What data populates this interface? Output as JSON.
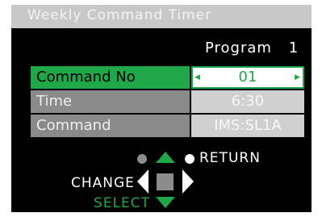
{
  "title": "Weekly Command Timer",
  "program": {
    "label": "Program",
    "number": "1"
  },
  "rows": [
    {
      "label": "Command No",
      "value": "01",
      "selected": true
    },
    {
      "label": "Time",
      "value": "6:30",
      "selected": false
    },
    {
      "label": "Command",
      "value": "IMS:SL1A",
      "selected": false
    }
  ],
  "nav": {
    "return_label": "RETURN",
    "change_label": "CHANGE",
    "select_label": "SELECT"
  },
  "colors": {
    "accent": "#1fa74a",
    "title_bar": "#c8c8c8",
    "background": "#000000",
    "dim_label": "#8a8a8a",
    "dim_value": "#d0d0d0"
  }
}
